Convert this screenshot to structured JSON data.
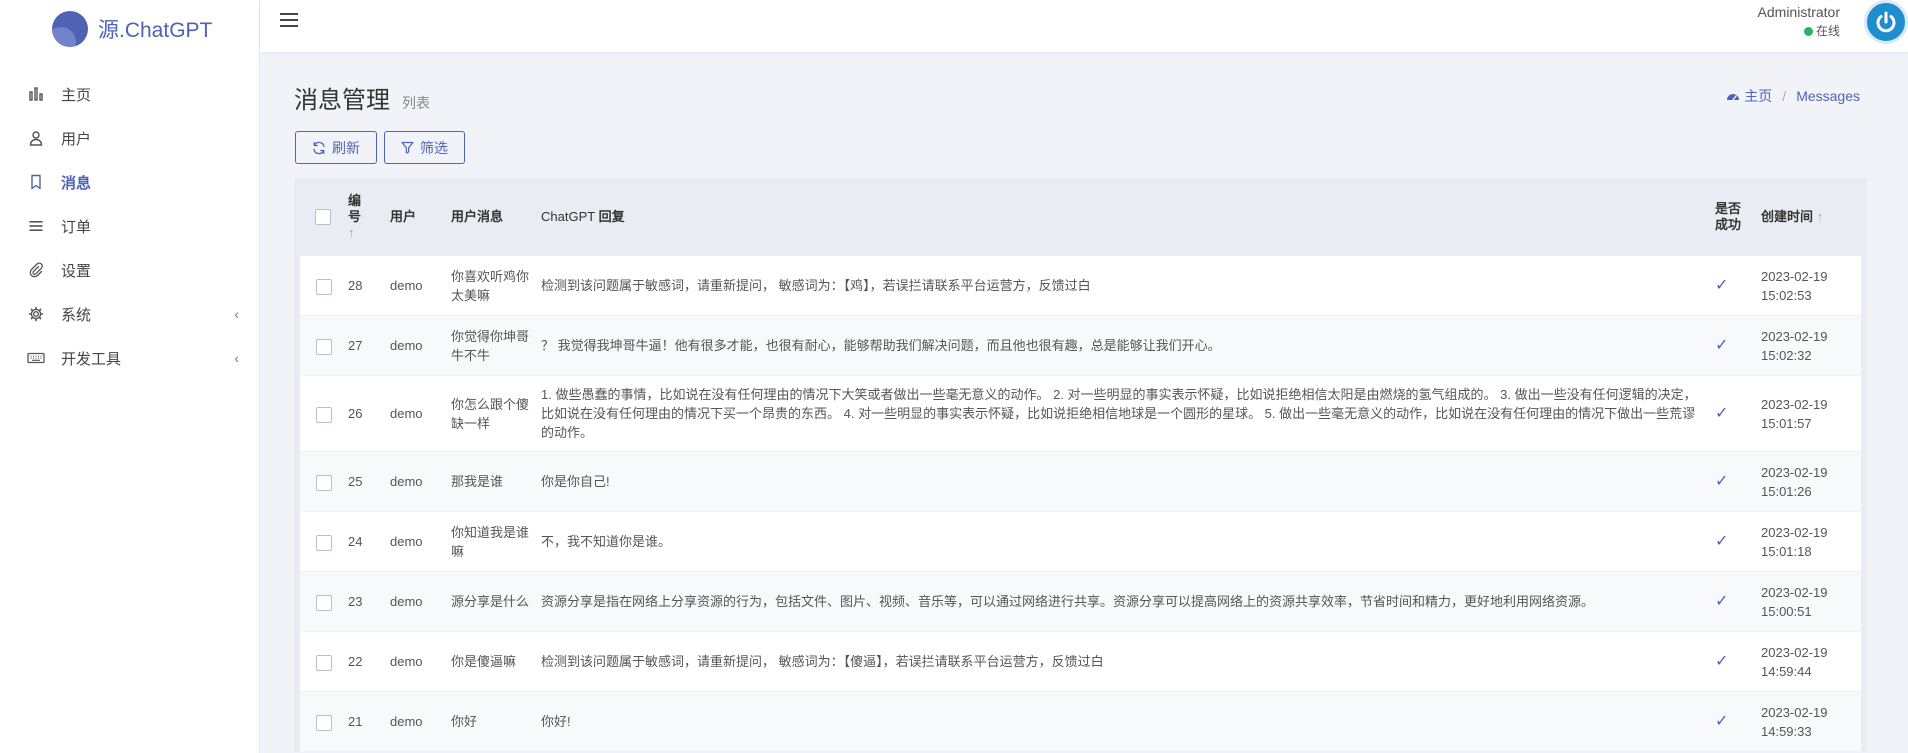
{
  "brand": {
    "name": "源.ChatGPT",
    "logo_color": "#4f63b5"
  },
  "sidebar": {
    "items": [
      {
        "label": "主页",
        "icon": "bar-chart-icon",
        "active": false,
        "has_children": false
      },
      {
        "label": "用户",
        "icon": "user-icon",
        "active": false,
        "has_children": false
      },
      {
        "label": "消息",
        "icon": "bookmark-icon",
        "active": true,
        "has_children": false
      },
      {
        "label": "订单",
        "icon": "list-icon",
        "active": false,
        "has_children": false
      },
      {
        "label": "设置",
        "icon": "paperclip-icon",
        "active": false,
        "has_children": false
      },
      {
        "label": "系统",
        "icon": "gear-icon",
        "active": false,
        "has_children": true
      },
      {
        "label": "开发工具",
        "icon": "keyboard-icon",
        "active": false,
        "has_children": true
      }
    ]
  },
  "topbar": {
    "user_name": "Administrator",
    "status": "在线",
    "status_color": "#28b463"
  },
  "page": {
    "title": "消息管理",
    "subtitle": "列表"
  },
  "breadcrumb": {
    "home": "主页",
    "current": "Messages"
  },
  "toolbar": {
    "refresh_label": "刷新",
    "filter_label": "筛选"
  },
  "table": {
    "headers": {
      "id": "编号",
      "user": "用户",
      "message": "用户消息",
      "reply_prefix": "ChatGPT ",
      "reply_bold": "回复",
      "success": "是否成功",
      "created": "创建时间"
    },
    "rows": [
      {
        "id": "28",
        "user": "demo",
        "message": "你喜欢听鸡你太美嘛",
        "reply": "检测到该问题属于敏感词，请重新提问， 敏感词为：【鸡】，若误拦请联系平台运营方，反馈过白",
        "date": "2023-02-19",
        "time": "15:02:53"
      },
      {
        "id": "27",
        "user": "demo",
        "message": "你觉得你坤哥牛不牛",
        "reply": "？ 我觉得我坤哥牛逼！他有很多才能，也很有耐心，能够帮助我们解决问题，而且他也很有趣，总是能够让我们开心。",
        "date": "2023-02-19",
        "time": "15:02:32"
      },
      {
        "id": "26",
        "user": "demo",
        "message": "你怎么跟个傻缺一样",
        "reply": "1. 做些愚蠢的事情，比如说在没有任何理由的情况下大笑或者做出一些毫无意义的动作。 2. 对一些明显的事实表示怀疑，比如说拒绝相信太阳是由燃烧的氢气组成的。 3. 做出一些没有任何逻辑的决定，比如说在没有任何理由的情况下买一个昂贵的东西。 4. 对一些明显的事实表示怀疑，比如说拒绝相信地球是一个圆形的星球。 5. 做出一些毫无意义的动作，比如说在没有任何理由的情况下做出一些荒谬的动作。",
        "date": "2023-02-19",
        "time": "15:01:57"
      },
      {
        "id": "25",
        "user": "demo",
        "message": "那我是谁",
        "reply": "你是你自己!",
        "date": "2023-02-19",
        "time": "15:01:26"
      },
      {
        "id": "24",
        "user": "demo",
        "message": "你知道我是谁嘛",
        "reply": "不，我不知道你是谁。",
        "date": "2023-02-19",
        "time": "15:01:18"
      },
      {
        "id": "23",
        "user": "demo",
        "message": "源分享是什么",
        "reply": "资源分享是指在网络上分享资源的行为，包括文件、图片、视频、音乐等，可以通过网络进行共享。资源分享可以提高网络上的资源共享效率，节省时间和精力，更好地利用网络资源。",
        "date": "2023-02-19",
        "time": "15:00:51"
      },
      {
        "id": "22",
        "user": "demo",
        "message": "你是傻逼嘛",
        "reply": "检测到该问题属于敏感词，请重新提问， 敏感词为：【傻逼】，若误拦请联系平台运营方，反馈过白",
        "date": "2023-02-19",
        "time": "14:59:44"
      },
      {
        "id": "21",
        "user": "demo",
        "message": "你好",
        "reply": "你好!",
        "date": "2023-02-19",
        "time": "14:59:33"
      }
    ]
  },
  "colors": {
    "accent": "#4f63b5",
    "success": "#28b463",
    "avatar": "#1f8ecf"
  }
}
